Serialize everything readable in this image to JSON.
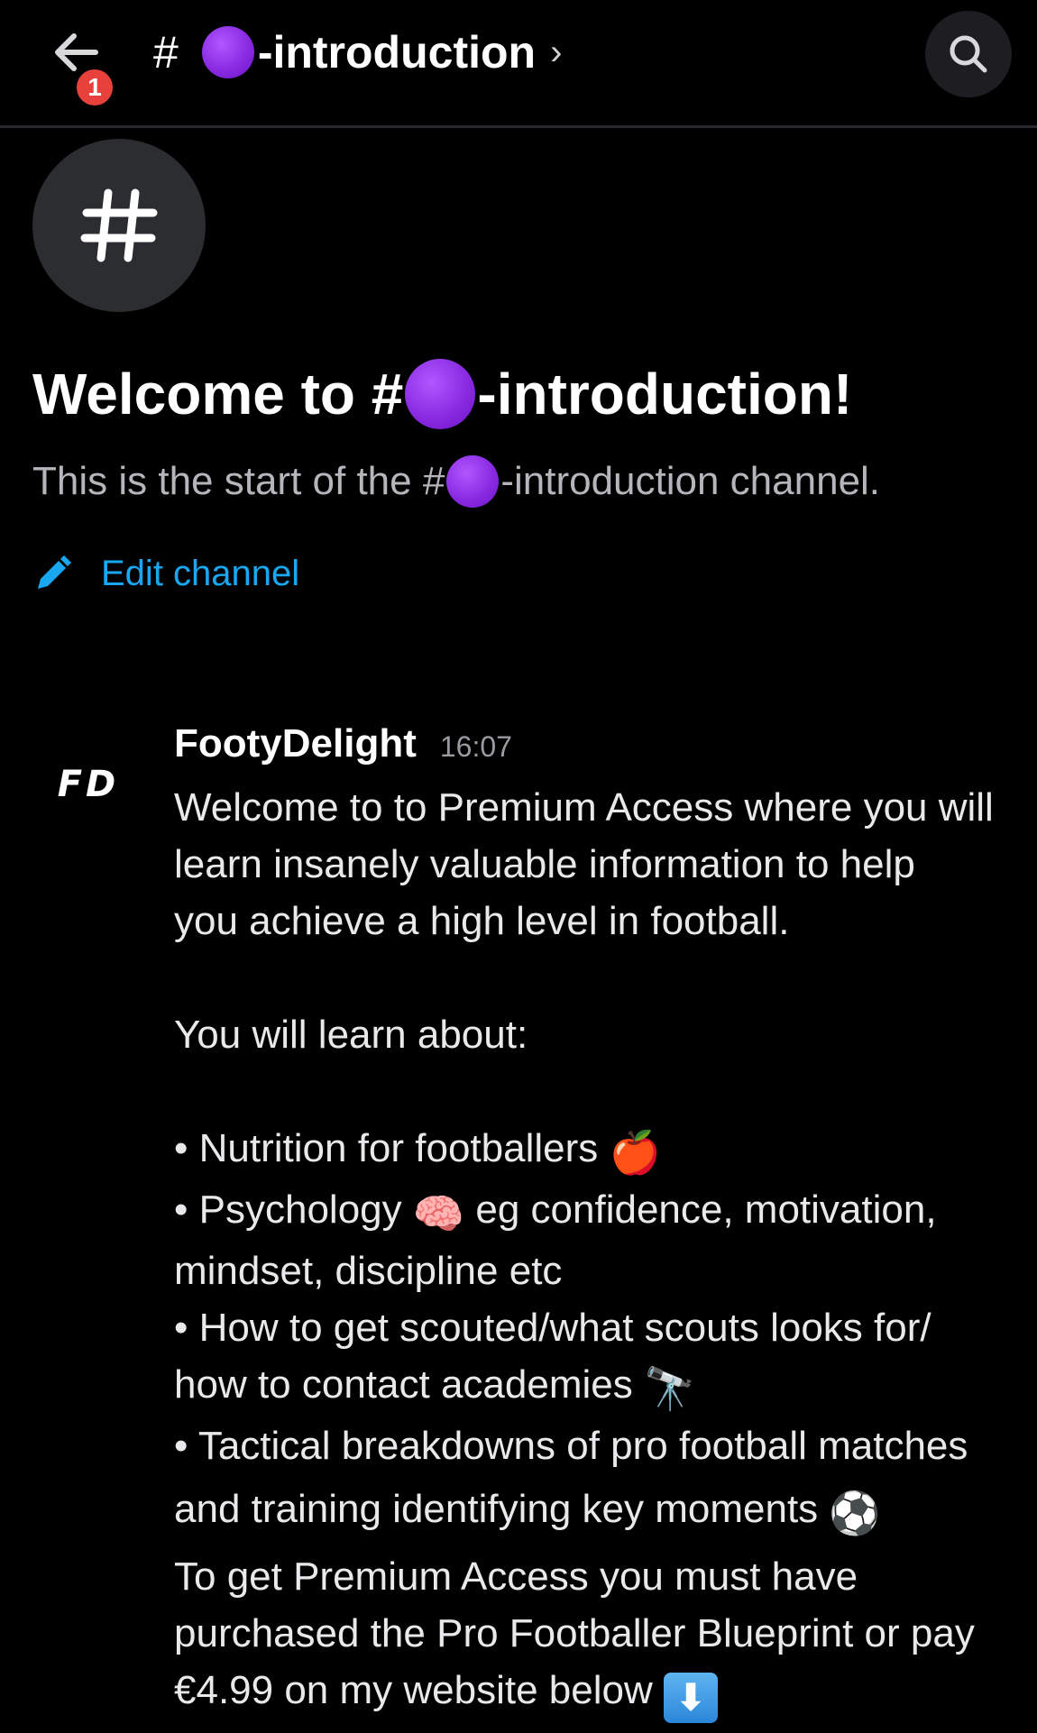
{
  "header": {
    "hash": "#",
    "channel_name": "-introduction",
    "chevron": "›",
    "notification_count": "1",
    "back_icon": "back-arrow-icon",
    "search_icon": "search-icon"
  },
  "channel_intro": {
    "avatar_glyph": "#",
    "title_prefix": "Welcome to #",
    "title_suffix": "-introduction!",
    "subtitle_prefix": "This is the start of the #",
    "subtitle_suffix": "-introduction channel.",
    "edit_label": "Edit channel",
    "accent_color": "#1aa7f2",
    "channel_emoji_color": "#8a2be2"
  },
  "message": {
    "author": "FootyDelight",
    "avatar_text": "FD",
    "time": "16:07",
    "lines": {
      "l1": "Welcome to to Premium Access where you will",
      "l2": "learn insanely valuable information to help",
      "l3": "you achieve a high level in football.",
      "l4": "You will learn about:",
      "l5": "• Nutrition for footballers ",
      "l6a": "• Psychology ",
      "l6b": " eg confidence, motivation,",
      "l7": "mindset, discipline etc",
      "l8": "• How to get scouted/what scouts looks for/",
      "l9": "how to contact academies ",
      "l10": "• Tactical breakdowns of pro football matches",
      "l11": "and training identifying key moments ",
      "l12": "To get Premium Access you must have",
      "l13": "purchased the Pro Footballer Blueprint or pay",
      "l14": "€4.99 on my website below "
    },
    "emojis": {
      "apple": "🍎",
      "brain": "🧠",
      "telescope": "🔭",
      "ball": "⚽",
      "down_arrow": "⬇"
    }
  }
}
